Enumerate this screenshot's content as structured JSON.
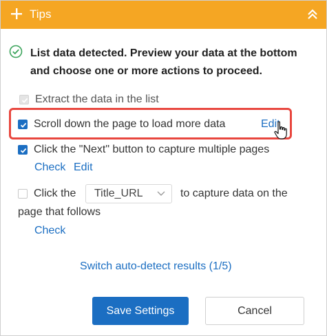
{
  "header": {
    "title": "Tips",
    "add_icon": "plus-icon",
    "collapse_icon": "chevron-double-up-icon"
  },
  "detection": {
    "icon": "check-circle-icon",
    "message": "List data detected. Preview your data at the bottom and choose one or more actions to proceed."
  },
  "actions": {
    "extract_list": {
      "label": "Extract the data in the list",
      "checked": true,
      "disabled": true
    },
    "scroll_down": {
      "label": "Scroll down the page to load more data",
      "checked": true,
      "edit_label": "Edit"
    },
    "click_next": {
      "label": "Click the \"Next\" button to capture multiple pages",
      "checked": true,
      "check_label": "Check",
      "edit_label": "Edit"
    },
    "click_field": {
      "label_before": "Click the",
      "select_value": "Title_URL",
      "label_after_line1": "to capture data on the",
      "label_after_line2": "page that follows",
      "checked": false,
      "check_label": "Check"
    }
  },
  "switch_link": "Switch auto-detect results (1/5)",
  "buttons": {
    "save": "Save Settings",
    "cancel": "Cancel"
  },
  "colors": {
    "header": "#f5a623",
    "primary": "#1b6ec2",
    "highlight": "#e8463e",
    "success": "#3aa35a"
  }
}
